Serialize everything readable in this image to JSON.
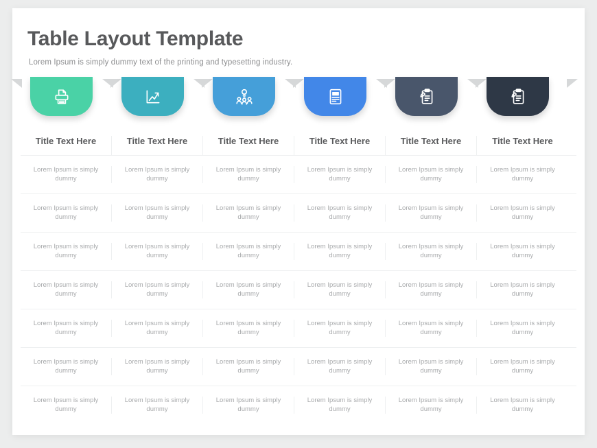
{
  "header": {
    "title": "Table Layout Template",
    "subtitle": "Lorem Ipsum is simply dummy text of the printing and typesetting industry."
  },
  "columns": [
    {
      "icon": "printer-document-icon",
      "color": "#4ad2a6",
      "title": "Title Text Here"
    },
    {
      "icon": "growth-chart-icon",
      "color": "#3cafbf",
      "title": "Title Text Here"
    },
    {
      "icon": "team-idea-icon",
      "color": "#459fd9",
      "title": "Title Text Here"
    },
    {
      "icon": "report-document-icon",
      "color": "#4287e8",
      "title": "Title Text Here"
    },
    {
      "icon": "clipboard-pen-icon",
      "color": "#49566b",
      "title": "Title Text Here"
    },
    {
      "icon": "clipboard-pen-icon",
      "color": "#2e3846",
      "title": "Title Text Here"
    }
  ],
  "cell_text": "Lorem Ipsum is simply dummy",
  "rows": [
    [
      "Lorem Ipsum is simply dummy",
      "Lorem Ipsum is simply dummy",
      "Lorem Ipsum is simply dummy",
      "Lorem Ipsum is simply dummy",
      "Lorem Ipsum is simply dummy",
      "Lorem Ipsum is simply dummy"
    ],
    [
      "Lorem Ipsum is simply dummy",
      "Lorem Ipsum is simply dummy",
      "Lorem Ipsum is simply dummy",
      "Lorem Ipsum is simply dummy",
      "Lorem Ipsum is simply dummy",
      "Lorem Ipsum is simply dummy"
    ],
    [
      "Lorem Ipsum is simply dummy",
      "Lorem Ipsum is simply dummy",
      "Lorem Ipsum is simply dummy",
      "Lorem Ipsum is simply dummy",
      "Lorem Ipsum is simply dummy",
      "Lorem Ipsum is simply dummy"
    ],
    [
      "Lorem Ipsum is simply dummy",
      "Lorem Ipsum is simply dummy",
      "Lorem Ipsum is simply dummy",
      "Lorem Ipsum is simply dummy",
      "Lorem Ipsum is simply dummy",
      "Lorem Ipsum is simply dummy"
    ],
    [
      "Lorem Ipsum is simply dummy",
      "Lorem Ipsum is simply dummy",
      "Lorem Ipsum is simply dummy",
      "Lorem Ipsum is simply dummy",
      "Lorem Ipsum is simply dummy",
      "Lorem Ipsum is simply dummy"
    ],
    [
      "Lorem Ipsum is simply dummy",
      "Lorem Ipsum is simply dummy",
      "Lorem Ipsum is simply dummy",
      "Lorem Ipsum is simply dummy",
      "Lorem Ipsum is simply dummy",
      "Lorem Ipsum is simply dummy"
    ],
    [
      "Lorem Ipsum is simply dummy",
      "Lorem Ipsum is simply dummy",
      "Lorem Ipsum is simply dummy",
      "Lorem Ipsum is simply dummy",
      "Lorem Ipsum is simply dummy",
      "Lorem Ipsum is simply dummy"
    ]
  ],
  "theme": {
    "page_background": "#eceded",
    "card_background": "#ffffff",
    "heading_color": "#58595b",
    "body_text_color": "#a7a9ab",
    "divider_color": "#eef0f1",
    "ribbon_wing_color": "#d6d8d9"
  }
}
